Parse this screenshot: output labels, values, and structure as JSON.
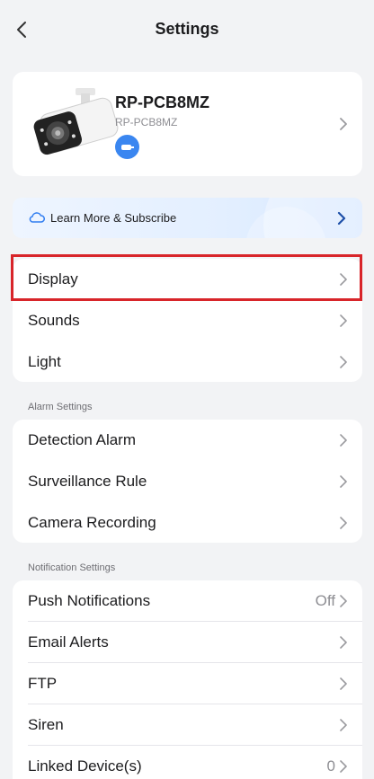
{
  "header": {
    "title": "Settings"
  },
  "device": {
    "name": "RP-PCB8MZ",
    "model": "RP-PCB8MZ"
  },
  "subscribe": {
    "label": "Learn More & Subscribe"
  },
  "group1": [
    {
      "label": "Display"
    },
    {
      "label": "Sounds"
    },
    {
      "label": "Light"
    }
  ],
  "alarm_section": {
    "title": "Alarm Settings",
    "items": [
      {
        "label": "Detection Alarm"
      },
      {
        "label": "Surveillance Rule"
      },
      {
        "label": "Camera Recording"
      }
    ]
  },
  "notification_section": {
    "title": "Notification Settings",
    "items": [
      {
        "label": "Push Notifications",
        "value": "Off"
      },
      {
        "label": "Email Alerts",
        "value": ""
      },
      {
        "label": "FTP",
        "value": ""
      },
      {
        "label": "Siren",
        "value": ""
      },
      {
        "label": "Linked Device(s)",
        "value": "0"
      }
    ]
  },
  "colors": {
    "accent": "#3a86f0",
    "highlight": "#d8252a",
    "background": "#f2f3f5"
  }
}
